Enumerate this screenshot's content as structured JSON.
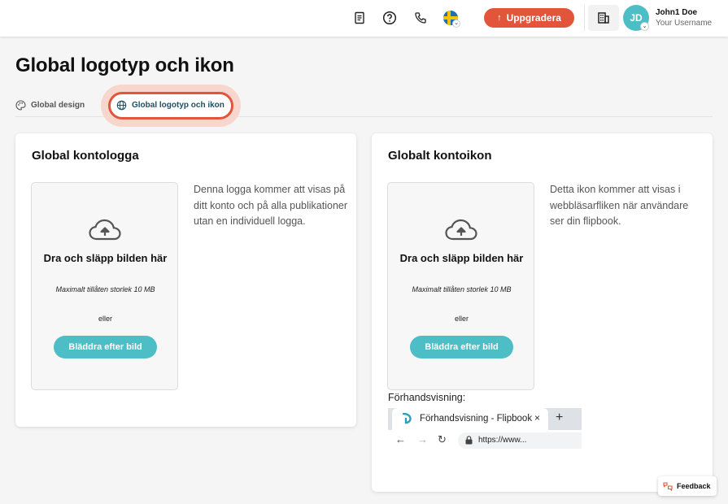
{
  "header": {
    "upgrade_label": "Uppgradera",
    "avatar_initials": "JD",
    "user_name": "John1 Doe",
    "user_subtitle": "Your Username",
    "icons": [
      "document-icon",
      "help-icon",
      "phone-icon",
      "sweden-flag-icon",
      "building-icon"
    ],
    "accent_color": "#e2553a"
  },
  "page": {
    "title": "Global logotyp och ikon"
  },
  "tabs": [
    {
      "label": "Global design",
      "icon": "palette-icon",
      "active": false
    },
    {
      "label": "Global logotyp och ikon",
      "icon": "globe-icon",
      "active": true
    }
  ],
  "logo_card": {
    "title": "Global kontologga",
    "dropzone_title": "Dra och släpp bilden här",
    "dropzone_limit": "Maximalt tillåten storlek 10 MB",
    "dropzone_or": "eller",
    "browse_label": "Bläddra efter bild",
    "description": "Denna logga kommer att visas på ditt konto och på alla publikationer utan en individuell logga."
  },
  "icon_card": {
    "title": "Globalt kontoikon",
    "dropzone_title": "Dra och släpp bilden här",
    "dropzone_limit": "Maximalt tillåten storlek 10 MB",
    "dropzone_or": "eller",
    "browse_label": "Bläddra efter bild",
    "description": "Detta ikon kommer att visas i webbläsarfliken när användare ser din flipbook.",
    "preview_label": "Förhandsvisning:",
    "preview_tab_title": "Förhandsvisning - Flipbook",
    "preview_close": "×",
    "preview_new_tab": "+",
    "preview_url": "https://www..."
  },
  "feedback": {
    "label": "Feedback"
  },
  "colors": {
    "teal": "#4dbdc6",
    "orange": "#e2553a"
  }
}
